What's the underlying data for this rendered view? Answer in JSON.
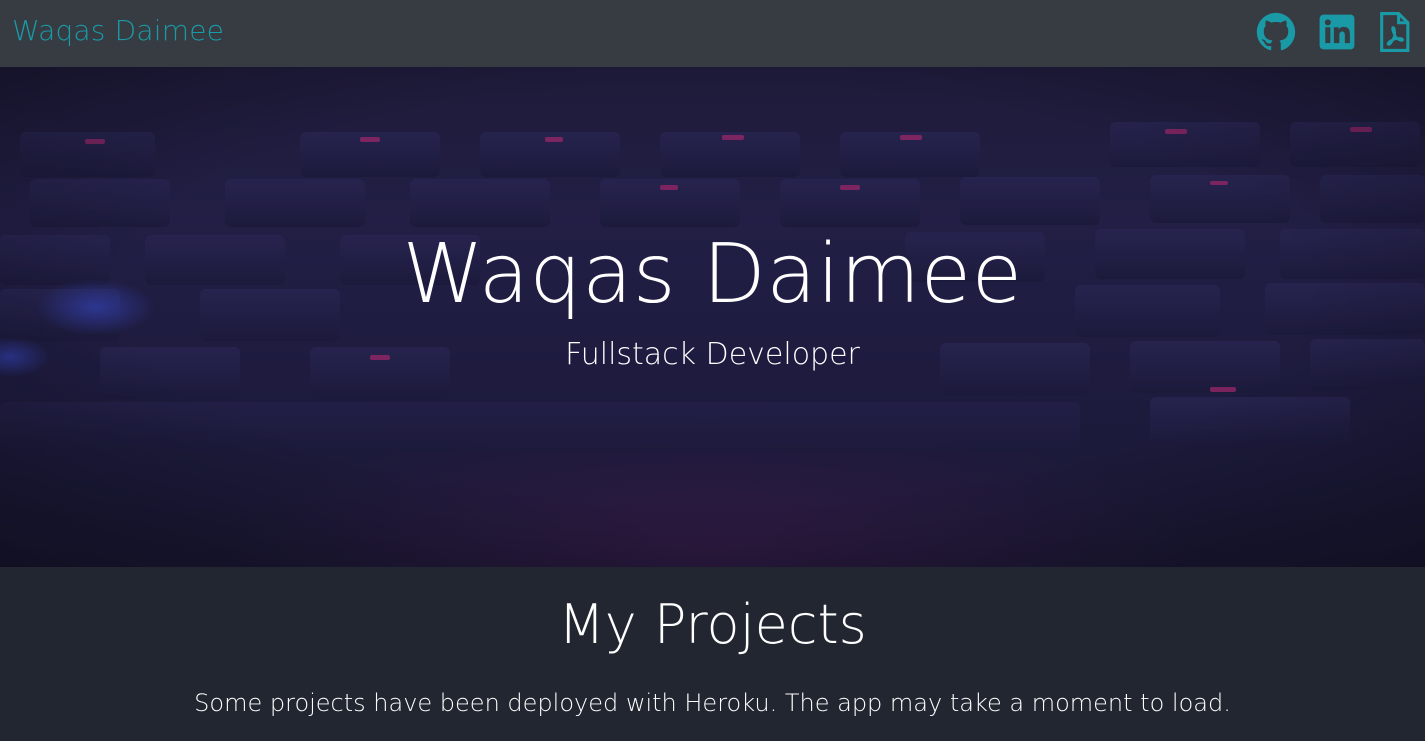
{
  "navbar": {
    "brand": "Waqas Daimee",
    "icons": [
      "github-icon",
      "linkedin-icon",
      "pdf-resume-icon"
    ],
    "accent_color": "#1a9aa6",
    "background_color": "#373b42"
  },
  "hero": {
    "title": "Waqas Daimee",
    "subtitle": "Fullstack Developer",
    "background_image": "dark keyboard with purple backlight"
  },
  "projects": {
    "title": "My Projects",
    "note": "Some projects have been deployed with Heroku. The app may take a moment to load.",
    "background_color": "#212630"
  }
}
